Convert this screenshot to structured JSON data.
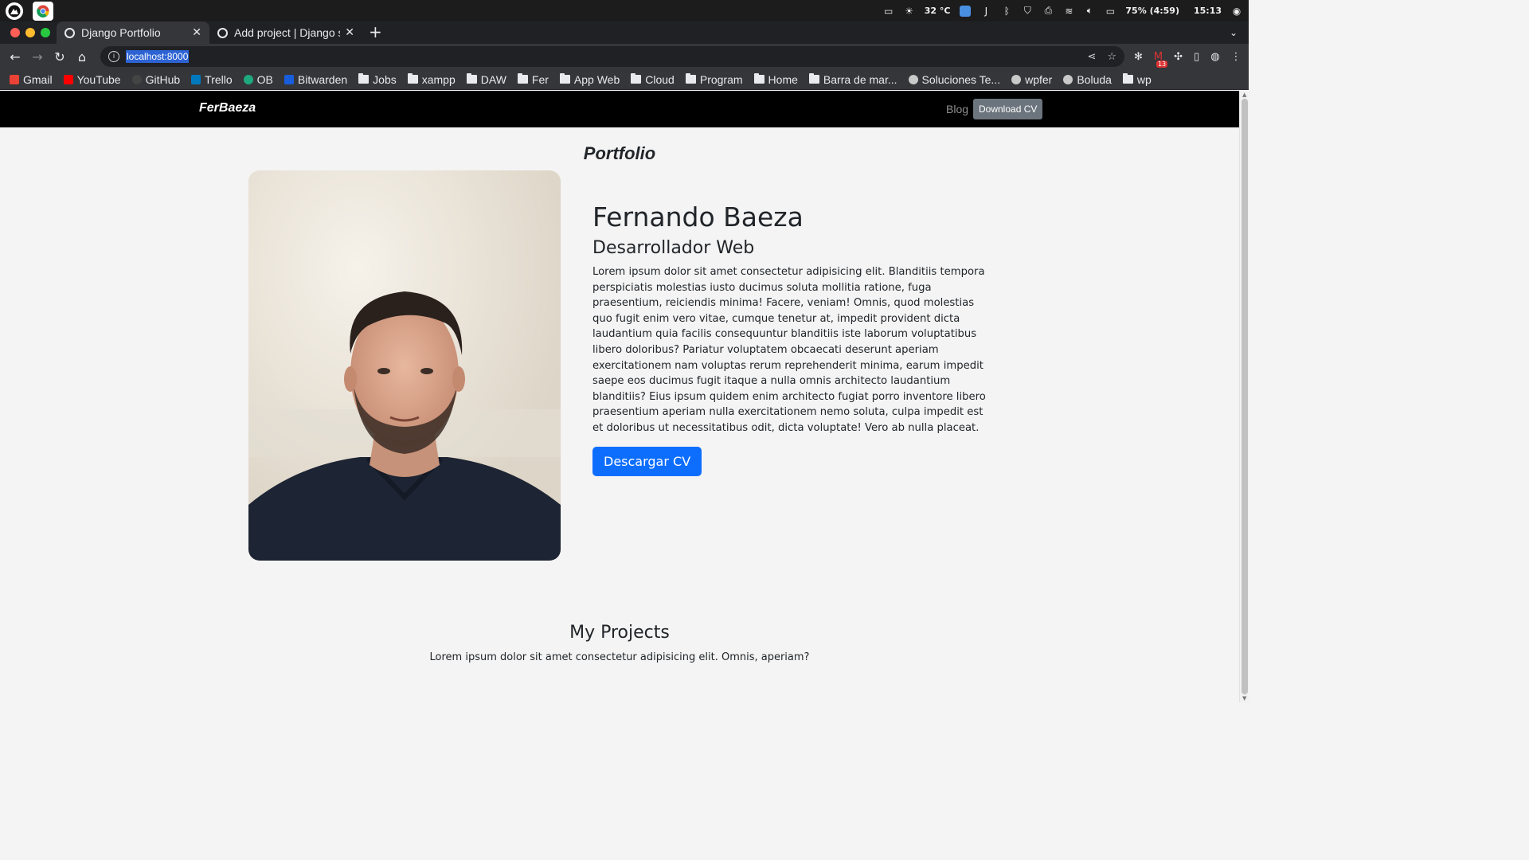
{
  "os": {
    "weather": "32 °C",
    "battery": "75% (4:59)",
    "time": "15:13"
  },
  "tabs": [
    {
      "title": "Django Portfolio",
      "active": true
    },
    {
      "title": "Add project | Django site",
      "active": false
    }
  ],
  "address_bar": {
    "url": "localhost:8000"
  },
  "bookmarks": [
    {
      "label": "Gmail",
      "icon": "gmail-icon"
    },
    {
      "label": "YouTube",
      "icon": "youtube-icon"
    },
    {
      "label": "GitHub",
      "icon": "github-icon"
    },
    {
      "label": "Trello",
      "icon": "trello-icon"
    },
    {
      "label": "OB",
      "icon": "ob-icon"
    },
    {
      "label": "Bitwarden",
      "icon": "bitwarden-icon"
    },
    {
      "label": "Jobs",
      "icon": "folder-icon"
    },
    {
      "label": "xampp",
      "icon": "folder-icon"
    },
    {
      "label": "DAW",
      "icon": "folder-icon"
    },
    {
      "label": "Fer",
      "icon": "folder-icon"
    },
    {
      "label": "App Web",
      "icon": "folder-icon"
    },
    {
      "label": "Cloud",
      "icon": "folder-icon"
    },
    {
      "label": "Program",
      "icon": "folder-icon"
    },
    {
      "label": "Home",
      "icon": "folder-icon"
    },
    {
      "label": "Barra de mar...",
      "icon": "folder-icon"
    },
    {
      "label": "Soluciones Te...",
      "icon": "site-icon"
    },
    {
      "label": "wpfer",
      "icon": "site-icon"
    },
    {
      "label": "Boluda",
      "icon": "site-icon"
    },
    {
      "label": "wp",
      "icon": "folder-icon"
    }
  ],
  "site": {
    "brand": "FerBaeza",
    "nav_blog": "Blog",
    "nav_cv": "Download CV",
    "page_title": "Portfolio",
    "name": "Fernando Baeza",
    "role": "Desarrollador Web",
    "bio": "Lorem ipsum dolor sit amet consectetur adipisicing elit. Blanditiis tempora perspiciatis molestias iusto ducimus soluta mollitia ratione, fuga praesentium, reiciendis minima! Facere, veniam! Omnis, quod molestias quo fugit enim vero vitae, cumque tenetur at, impedit provident dicta laudantium quia facilis consequuntur blanditiis iste laborum voluptatibus libero doloribus? Pariatur voluptatem obcaecati deserunt aperiam exercitationem nam voluptas rerum reprehenderit minima, earum impedit saepe eos ducimus fugit itaque a nulla omnis architecto laudantium blanditiis? Eius ipsum quidem enim architecto fugiat porro inventore libero praesentium aperiam nulla exercitationem nemo soluta, culpa impedit est et doloribus ut necessitatibus odit, dicta voluptate! Vero ab nulla placeat.",
    "cta": "Descargar CV",
    "projects_title": "My Projects",
    "projects_desc": "Lorem ipsum dolor sit amet consectetur adipisicing elit. Omnis, aperiam?"
  },
  "colors": {
    "primary": "#0d6efd",
    "navbar": "#000000",
    "secondary_btn": "#6c757d",
    "page_bg": "#f4f4f4"
  }
}
